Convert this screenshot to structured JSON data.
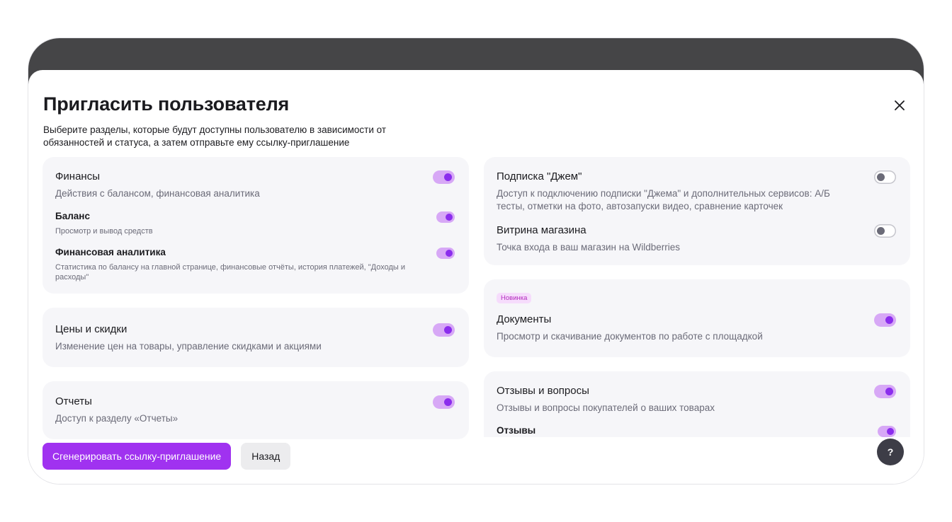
{
  "modal": {
    "title": "Пригласить пользователя",
    "subtitle": "Выберите разделы, которые будут доступны пользователю в зависимости от обязанностей и статуса, а затем отправьте ему ссылку-приглашение"
  },
  "left_sections": [
    {
      "title": "Финансы",
      "description": "Действия с балансом, финансовая аналитика",
      "enabled": true,
      "subitems": [
        {
          "title": "Баланс",
          "description": "Просмотр и вывод средств",
          "enabled": true
        },
        {
          "title": "Финансовая аналитика",
          "description": "Статистика по балансу на главной странице, финансовые отчёты, история платежей, \"Доходы и расходы\"",
          "enabled": true
        }
      ]
    },
    {
      "title": "Цены и скидки",
      "description": "Изменение цен на товары, управление скидками и акциями",
      "enabled": true
    },
    {
      "title": "Отчеты",
      "description": "Доступ к разделу «Отчеты»",
      "enabled": true
    }
  ],
  "right_sections": [
    {
      "items": [
        {
          "title": "Подписка \"Джем\"",
          "description": "Доступ к подключению подписки \"Джема\" и дополнительных сервисов: А/Б тесты, отметки на фото, автозапуски видео, сравнение карточек",
          "enabled": false
        },
        {
          "title": "Витрина магазина",
          "description": "Точка входа в ваш магазин на Wildberries",
          "enabled": false
        }
      ]
    },
    {
      "badge": "Новинка",
      "items": [
        {
          "title": "Документы",
          "description": "Просмотр и скачивание документов по работе с площадкой",
          "enabled": true
        }
      ]
    },
    {
      "items": [
        {
          "title": "Отзывы и вопросы",
          "description": "Отзывы и вопросы покупателей о ваших товарах",
          "enabled": true
        }
      ],
      "subitems": [
        {
          "title": "Отзывы",
          "enabled": true
        }
      ]
    }
  ],
  "footer": {
    "primary_label": "Сгенерировать ссылку-приглашение",
    "secondary_label": "Назад"
  },
  "help": {
    "label": "?"
  },
  "colors": {
    "accent": "#a032f0",
    "toggle_on_track": "#d7a8f6",
    "toggle_on_knob": "#8b2ded",
    "badge_bg": "#f6dcfc",
    "badge_text": "#b32bbd"
  }
}
